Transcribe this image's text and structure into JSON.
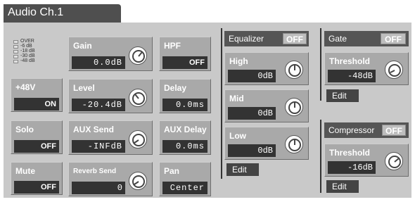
{
  "title": "Audio Ch.1",
  "meter": {
    "labels": [
      "OVER",
      "-6 dB",
      "-18 dB",
      "-30 dB",
      "-48 dB"
    ]
  },
  "controls": {
    "gain": {
      "label": "Gain",
      "value": "0.0dB"
    },
    "level": {
      "label": "Level",
      "value": "-20.4dB"
    },
    "aux_send": {
      "label": "AUX Send",
      "value": "-INFdB"
    },
    "reverb_send": {
      "label": "Reverb Send",
      "value": "0"
    },
    "phantom": {
      "label": "+48V",
      "value": "ON"
    },
    "solo": {
      "label": "Solo",
      "value": "OFF"
    },
    "mute": {
      "label": "Mute",
      "value": "OFF"
    },
    "hpf": {
      "label": "HPF",
      "value": "OFF"
    },
    "delay": {
      "label": "Delay",
      "value": "0.0ms"
    },
    "aux_delay": {
      "label": "AUX Delay",
      "value": "0.0ms"
    },
    "pan": {
      "label": "Pan",
      "value": "Center"
    }
  },
  "equalizer": {
    "label": "Equalizer",
    "state": "OFF",
    "high": {
      "label": "High",
      "value": "0dB"
    },
    "mid": {
      "label": "Mid",
      "value": "0dB"
    },
    "low": {
      "label": "Low",
      "value": "0dB"
    },
    "edit": "Edit"
  },
  "gate": {
    "label": "Gate",
    "state": "OFF",
    "threshold": {
      "label": "Threshold",
      "value": "-48dB"
    },
    "edit": "Edit"
  },
  "compressor": {
    "label": "Compressor",
    "state": "OFF",
    "threshold": {
      "label": "Threshold",
      "value": "-16dB"
    },
    "edit": "Edit"
  }
}
